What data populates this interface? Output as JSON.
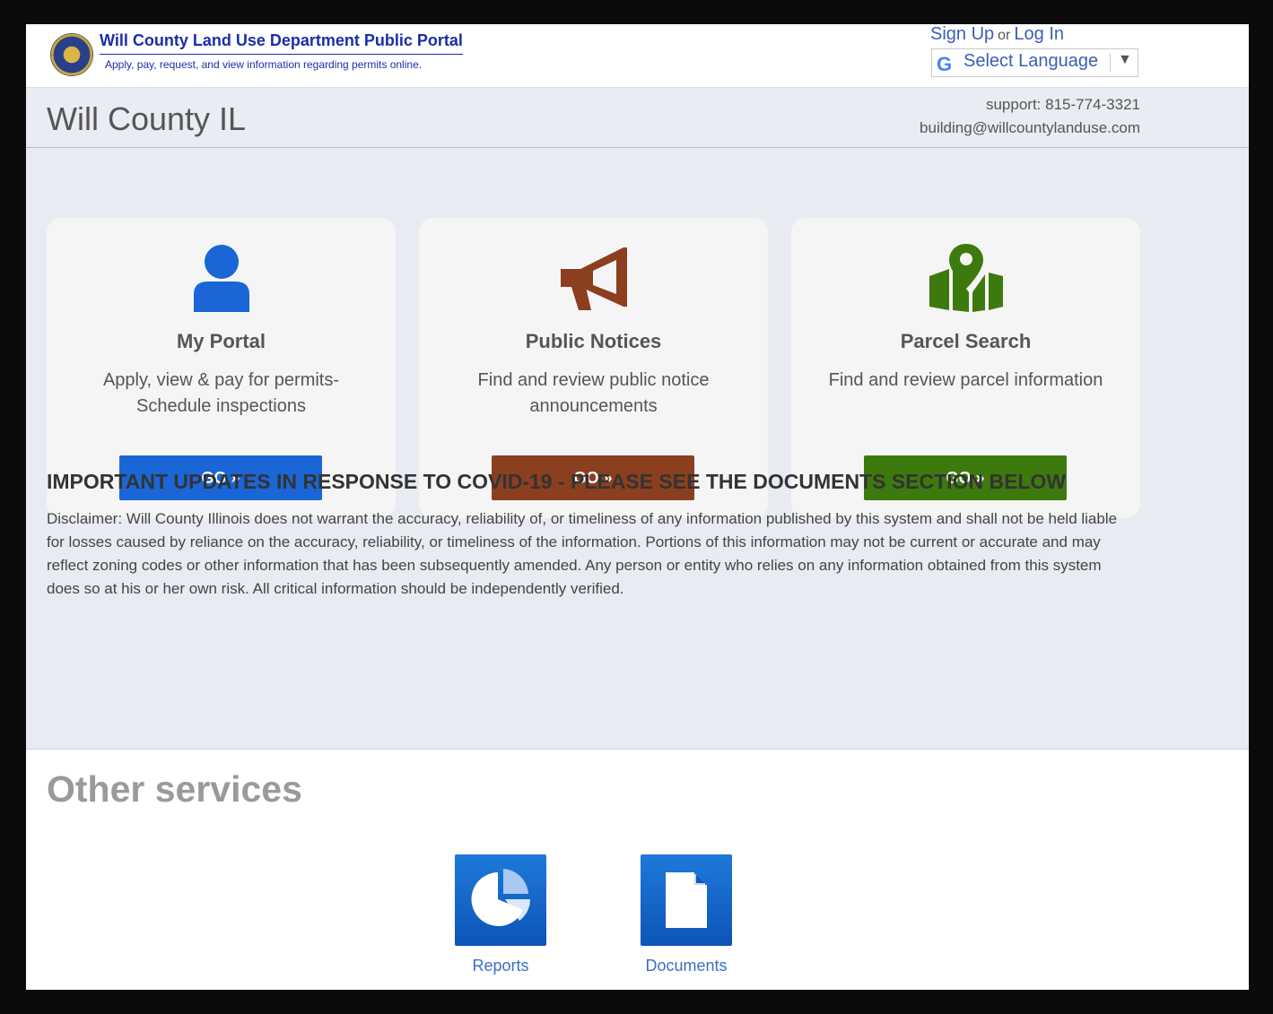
{
  "header": {
    "portal_title": "Will County Land Use Department Public Portal",
    "portal_subtitle": "Apply, pay, request, and view information regarding permits online.",
    "sign_up": "Sign Up",
    "or": "or",
    "log_in": "Log In",
    "language_label": "Select Language",
    "language_icon": "G",
    "language_arrow": "▼"
  },
  "band": {
    "county": "Will County IL",
    "support": "support: 815-774-3321",
    "email": "building@willcountylanduse.com"
  },
  "cards": [
    {
      "title": "My Portal",
      "desc_line1": "Apply, view & pay for permits-",
      "desc_line2": "Schedule inspections",
      "button": "GO »",
      "color": "#1a66d6",
      "icon": "user-icon"
    },
    {
      "title": "Public Notices",
      "desc_line1": "Find and review public notice",
      "desc_line2": "announcements",
      "button": "GO »",
      "color": "#8c3f1f",
      "icon": "megaphone-icon"
    },
    {
      "title": "Parcel Search",
      "desc_line1": "Find and review parcel information",
      "desc_line2": "",
      "button": "GO »",
      "color": "#3d7a0d",
      "icon": "map-pin-icon"
    }
  ],
  "covid_heading": "IMPORTANT UPDATES IN RESPONSE TO COVID-19 - PLEASE SEE THE DOCUMENTS SECTION BELOW",
  "disclaimer": "Disclaimer:  Will County Illinois does not warrant the accuracy, reliability of, or timeliness of any information published by this system and shall not be held liable for losses caused by reliance on the accuracy, reliability, or timeliness of the information. Portions of this information may not be current or accurate and may reflect zoning codes or other information that has been subsequently amended. Any person or entity who relies on any information obtained from this system does so at his or her own risk. All critical information should be independently verified.",
  "other_services": {
    "title": "Other services",
    "items": [
      {
        "label": "Reports",
        "icon": "pie-chart-icon"
      },
      {
        "label": "Documents",
        "icon": "document-icon"
      }
    ]
  }
}
